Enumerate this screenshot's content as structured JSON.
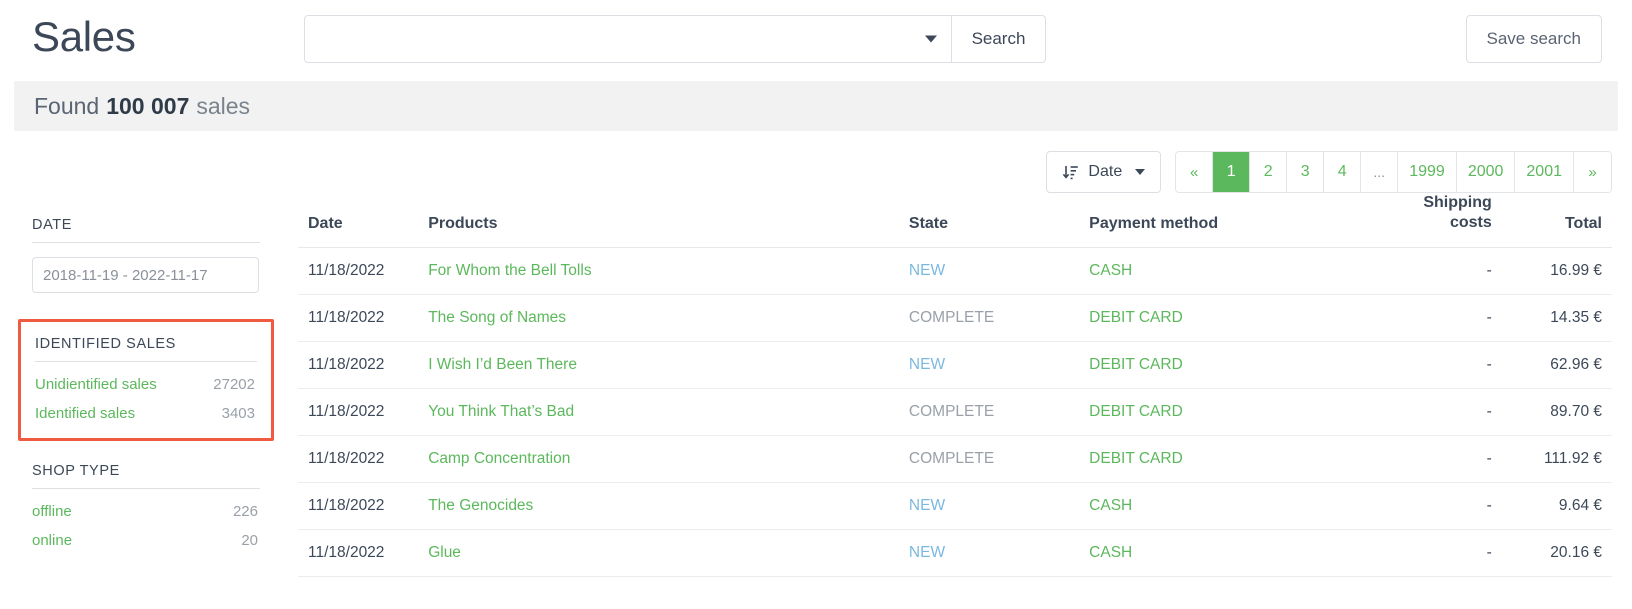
{
  "header": {
    "title": "Sales",
    "search": {
      "value": "",
      "placeholder": "",
      "caret_icon": "chevron-down-icon",
      "search_button": "Search"
    },
    "save_search_button": "Save search"
  },
  "found_banner": {
    "lead": "Found",
    "count": "100 007",
    "trail": "sales"
  },
  "toolbar": {
    "sort": {
      "icon": "sort-descending-icon",
      "label": "Date",
      "caret_icon": "chevron-down-icon"
    },
    "pagination": {
      "prev": "«",
      "next": "»",
      "ellipsis": "...",
      "pages": [
        "1",
        "2",
        "3",
        "4"
      ],
      "tail_pages": [
        "1999",
        "2000",
        "2001"
      ],
      "active": "1"
    }
  },
  "sidebar": {
    "facets": [
      {
        "title": "DATE",
        "type": "date-range",
        "value": "2018-11-19 - 2022-11-17",
        "highlighted": false
      },
      {
        "title": "IDENTIFIED SALES",
        "type": "list",
        "highlighted": true,
        "rows": [
          {
            "label": "Unidientified sales",
            "count": "27202"
          },
          {
            "label": "Identified sales",
            "count": "3403"
          }
        ]
      },
      {
        "title": "SHOP TYPE",
        "type": "list",
        "highlighted": false,
        "rows": [
          {
            "label": "offline",
            "count": "226"
          },
          {
            "label": "online",
            "count": "20"
          }
        ]
      }
    ]
  },
  "table": {
    "columns": [
      {
        "key": "date",
        "label": "Date"
      },
      {
        "key": "prod",
        "label": "Products"
      },
      {
        "key": "state",
        "label": "State"
      },
      {
        "key": "pay",
        "label": "Payment method"
      },
      {
        "key": "ship",
        "label": "Shipping costs",
        "line1": "Shipping",
        "line2": "costs"
      },
      {
        "key": "total",
        "label": "Total"
      }
    ],
    "rows": [
      {
        "date": "11/18/2022",
        "product": "For Whom the Bell Tolls",
        "state": "NEW",
        "payment": "CASH",
        "shipping": "-",
        "total": "16.99 €"
      },
      {
        "date": "11/18/2022",
        "product": "The Song of Names",
        "state": "COMPLETE",
        "payment": "DEBIT CARD",
        "shipping": "-",
        "total": "14.35 €"
      },
      {
        "date": "11/18/2022",
        "product": "I Wish I’d Been There",
        "state": "NEW",
        "payment": "DEBIT CARD",
        "shipping": "-",
        "total": "62.96 €"
      },
      {
        "date": "11/18/2022",
        "product": "You Think That’s Bad",
        "state": "COMPLETE",
        "payment": "DEBIT CARD",
        "shipping": "-",
        "total": "89.70 €"
      },
      {
        "date": "11/18/2022",
        "product": "Camp Concentration",
        "state": "COMPLETE",
        "payment": "DEBIT CARD",
        "shipping": "-",
        "total": "111.92 €"
      },
      {
        "date": "11/18/2022",
        "product": "The Genocides",
        "state": "NEW",
        "payment": "CASH",
        "shipping": "-",
        "total": "9.64 €"
      },
      {
        "date": "11/18/2022",
        "product": "Glue",
        "state": "NEW",
        "payment": "CASH",
        "shipping": "-",
        "total": "20.16 €"
      }
    ]
  },
  "colors": {
    "accent_green": "#5cb85c",
    "state_new": "#7ab8e0",
    "state_complete": "#9aa0a8",
    "highlight_box": "#f05a41",
    "text_dark": "#3c4858"
  }
}
